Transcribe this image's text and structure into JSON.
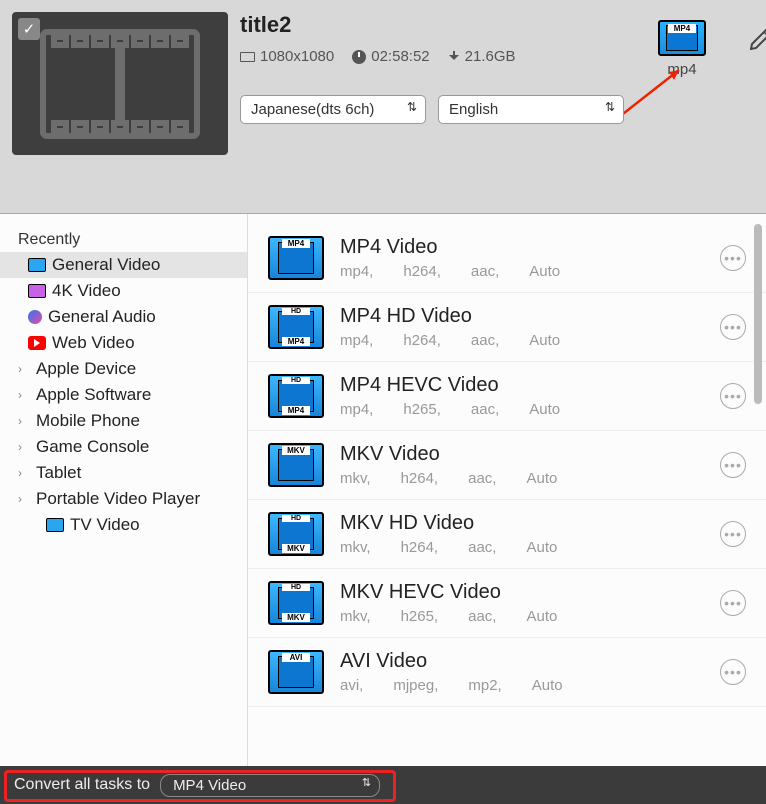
{
  "task": {
    "title": "title2",
    "resolution": "1080x1080",
    "duration": "02:58:52",
    "filesize": "21.6GB",
    "format_label": "mp4",
    "audio_track": "Japanese(dts 6ch)",
    "subtitle": "English"
  },
  "sidebar": {
    "header": "Recently",
    "items": [
      {
        "label": "General Video",
        "icon": "film",
        "selected": true
      },
      {
        "label": "4K Video",
        "icon": "4k"
      },
      {
        "label": "General Audio",
        "icon": "audio"
      },
      {
        "label": "Web Video",
        "icon": "yt"
      }
    ],
    "categories": [
      {
        "label": "Apple Device"
      },
      {
        "label": "Apple Software"
      },
      {
        "label": "Mobile Phone"
      },
      {
        "label": "Game Console"
      },
      {
        "label": "Tablet"
      },
      {
        "label": "Portable Video Player"
      }
    ],
    "tv": {
      "label": "TV Video"
    }
  },
  "formats": [
    {
      "name": "MP4 Video",
      "tag": "MP4",
      "hd": false,
      "d": [
        "mp4,",
        "h264,",
        "aac,",
        "Auto"
      ]
    },
    {
      "name": "MP4 HD Video",
      "tag": "MP4",
      "hd": true,
      "d": [
        "mp4,",
        "h264,",
        "aac,",
        "Auto"
      ]
    },
    {
      "name": "MP4 HEVC Video",
      "tag": "MP4",
      "hd": true,
      "d": [
        "mp4,",
        "h265,",
        "aac,",
        "Auto"
      ]
    },
    {
      "name": "MKV Video",
      "tag": "MKV",
      "hd": false,
      "d": [
        "mkv,",
        "h264,",
        "aac,",
        "Auto"
      ]
    },
    {
      "name": "MKV HD Video",
      "tag": "MKV",
      "hd": true,
      "d": [
        "mkv,",
        "h264,",
        "aac,",
        "Auto"
      ]
    },
    {
      "name": "MKV HEVC Video",
      "tag": "MKV",
      "hd": true,
      "d": [
        "mkv,",
        "h265,",
        "aac,",
        "Auto"
      ]
    },
    {
      "name": "AVI Video",
      "tag": "AVI",
      "hd": false,
      "d": [
        "avi,",
        "mjpeg,",
        "mp2,",
        "Auto"
      ]
    }
  ],
  "footer": {
    "label": "Convert all tasks to",
    "selected": "MP4 Video"
  }
}
